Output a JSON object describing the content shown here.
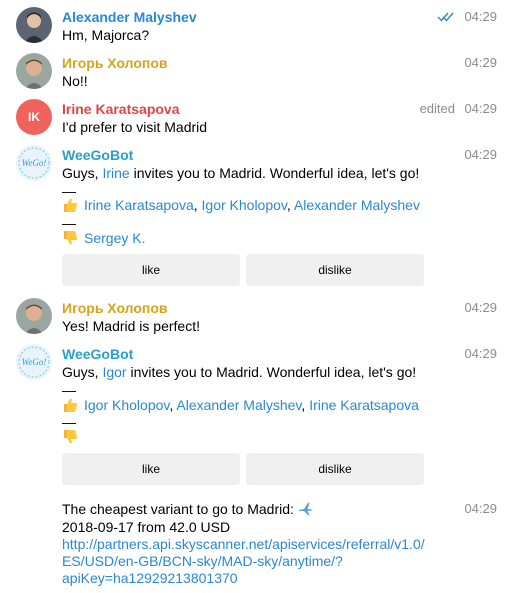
{
  "colors": {
    "name_blue": "#2a88d0",
    "name_gold": "#d4a51c",
    "name_red": "#e04545",
    "name_teal": "#2aa0c8",
    "link": "#2a88d0",
    "button_bg": "#f0f0f0",
    "time": "#8c8c8c",
    "ik_avatar": "#f0635c"
  },
  "messages": [
    {
      "sender": "Alexander Malyshev",
      "text": "Hm, Majorca?",
      "time": "04:29",
      "read_icon": "double-check-icon"
    },
    {
      "sender": "Игорь Холопов",
      "text": "No!!",
      "time": "04:29"
    },
    {
      "sender": "Irine Karatsapova",
      "avatar_initials": "IK",
      "text": "I'd prefer to visit Madrid",
      "edited": "edited",
      "time": "04:29"
    },
    {
      "sender": "WeeGoBot",
      "avatar_text": "WeGo!",
      "text_pre": "Guys, ",
      "mention": "Irine",
      "text_post": " invites you to Madrid. Wonderful idea, let's go!",
      "dash": "—",
      "like_icon": "thumbs-up-icon",
      "like_names": [
        "Irine Karatsapova",
        "Igor Kholopov",
        "Alexander Malyshev"
      ],
      "sep1": ", ",
      "sep2": ", ",
      "dash2": "—",
      "dislike_icon": "thumbs-down-icon",
      "dislike_names": [
        "Sergey K."
      ],
      "buttons": [
        "like",
        "dislike"
      ],
      "time": "04:29"
    },
    {
      "sender": "Игорь Холопов",
      "text": "Yes! Madrid is perfect!",
      "time": "04:29"
    },
    {
      "sender": "WeeGoBot",
      "avatar_text": "WeGo!",
      "text_pre": "Guys, ",
      "mention": "Igor",
      "text_post": " invites you to Madrid. Wonderful idea, let's go!",
      "dash": "—",
      "like_icon": "thumbs-up-icon",
      "like_names": [
        "Igor Kholopov",
        "Alexander Malyshev",
        "Irine Karatsapova"
      ],
      "sep1": ", ",
      "sep2": ", ",
      "dash2": "—",
      "dislike_icon": "thumbs-down-icon",
      "buttons": [
        "like",
        "dislike"
      ],
      "time": "04:29"
    },
    {
      "text1": "The cheapest variant to go to Madrid:",
      "plane_icon": "airplane-icon",
      "text2": "2018-09-17 from 42.0 USD",
      "url_lines": [
        "http://partners.api.skyscanner.net/apiservices/referral/v1.0/",
        "ES/USD/en-GB/BCN-sky/MAD-sky/anytime/?",
        "apiKey=ha12929213801370"
      ],
      "time": "04:29"
    }
  ]
}
